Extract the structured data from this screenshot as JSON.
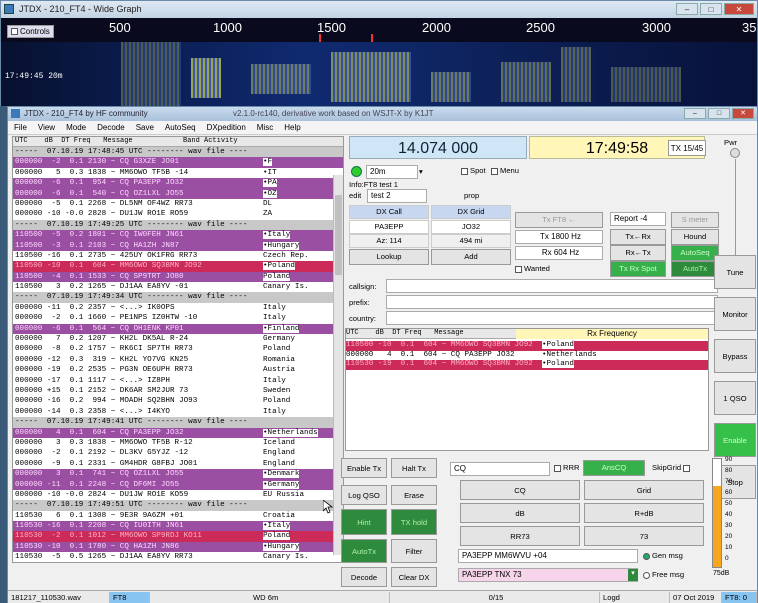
{
  "waterfall": {
    "title": "JTDX - 210_FT4 - Wide Graph",
    "controls_label": "Controls",
    "scale": [
      "500",
      "1000",
      "1500",
      "2000",
      "2500",
      "3000",
      "35"
    ],
    "time_label": "17:49:45   20m",
    "min": "–",
    "max": "□",
    "close": "✕"
  },
  "main": {
    "title": "JTDX - 210_FT4 by HF community",
    "subtitle": "v2.1.0-rc140, derivative work based on WSJT-X by K1JT",
    "min": "–",
    "max": "□",
    "close": "✕"
  },
  "menu": [
    "File",
    "View",
    "Mode",
    "Decode",
    "Save",
    "AutoSeq",
    "DXpedition",
    "Misc",
    "Help"
  ],
  "band_activity": {
    "header": "UTC    dB  DT Freq   Message            Band Activity",
    "rows": [
      {
        "t": "-----  07.10.19 17:48:45 UTC -------- wav file ----",
        "c": "",
        "k": "sep"
      },
      {
        "t": "000000  -2  0.1 2130 ~ CQ G3XZE JO01",
        "c": "•F",
        "k": "cq"
      },
      {
        "t": "000000   5  0.3 1838 ~ MM6OWO TF5B -14",
        "c": "•IT",
        "k": ""
      },
      {
        "t": "000000  -6  0.1  954 ~ CQ PA3EPP JO32",
        "c": "•PA",
        "k": "cq"
      },
      {
        "t": "000000  -6  0.1  540 ~ CQ OZ1LXL JO55",
        "c": "•OZ",
        "k": "cq"
      },
      {
        "t": "000000  -5  0.1 2268 ~ DL5NM OF4WZ RR73",
        "c": "DL",
        "k": ""
      },
      {
        "t": "000000 -10 -0.0 2828 ~ DU1JW RO1E RO59",
        "c": "ZA",
        "k": ""
      },
      {
        "t": "-----  07.10.19 17:49:25 UTC -------- wav file ----",
        "c": "",
        "k": "sep"
      },
      {
        "t": "110500  -5  0.2 1801 ~ CQ IW0FEH JN61",
        "c": "•Italy",
        "k": "cq"
      },
      {
        "t": "110500  -3  0.1 2103 ~ CQ HA1ZH JN87",
        "c": "•Hungary",
        "k": "cq"
      },
      {
        "t": "110500 -16  0.1 2735 ~ 425UY OK1FRG RR73",
        "c": "Czech Rep.",
        "k": ""
      },
      {
        "t": "110500 -10  0.1  604 ~ MM6OWO SQ3BMN JO92",
        "c": "•Poland",
        "k": "me"
      },
      {
        "t": "110500  -4  0.1 1533 ~ CQ SP9TRT JO80",
        "c": "Poland",
        "k": "cq"
      },
      {
        "t": "110500   3  0.2 1265 ~ DJ1AA EA8YV -01",
        "c": "Canary Is.",
        "k": ""
      },
      {
        "t": "-----  07.10.19 17:49:34 UTC -------- wav file ----",
        "c": "",
        "k": "sep"
      },
      {
        "t": "000000 -11  0.2 2357 ~ <...> IK0OPS",
        "c": "Italy",
        "k": ""
      },
      {
        "t": "000000  -2  0.1 1660 ~ PE1NPS IZ0HTW -10",
        "c": "Italy",
        "k": ""
      },
      {
        "t": "000000  -6  0.1  564 ~ CQ OH1ENK KP01",
        "c": "•Finland",
        "k": "cq"
      },
      {
        "t": "000000   7  0.2 1207 ~ KH2L DK5AL R-24",
        "c": "Germany",
        "k": ""
      },
      {
        "t": "000000  -8  0.2 1757 ~ RK6CI SP7TH RR73",
        "c": "Poland",
        "k": ""
      },
      {
        "t": "000000 -12  0.3  319 ~ KH2L YO7VG KN25",
        "c": "Romania",
        "k": ""
      },
      {
        "t": "000000 -19  0.2 2535 ~ PG3N OE6UPH RR73",
        "c": "Austria",
        "k": ""
      },
      {
        "t": "000000 -17  0.1 1117 ~ <...> IZ8PH",
        "c": "Italy",
        "k": ""
      },
      {
        "t": "000000 +15  0.1 2152 ~ DK6AR SM2JUR 73",
        "c": "Sweden",
        "k": ""
      },
      {
        "t": "000000 -16  0.2  994 ~ MOADH SQ2BHN JO93",
        "c": "Poland",
        "k": ""
      },
      {
        "t": "000000 -14  0.3 2358 ~ <...> I4KYO",
        "c": "Italy",
        "k": ""
      },
      {
        "t": "-----  07.10.19 17:49:41 UTC -------- wav file ----",
        "c": "",
        "k": "sep"
      },
      {
        "t": "000000   4  0.1  604 ~ CQ PA3EPP JO32",
        "c": "•Netherlands",
        "k": "cq"
      },
      {
        "t": "000000   3  0.3 1838 ~ MM6OWO TF5B R-12",
        "c": "Iceland",
        "k": ""
      },
      {
        "t": "000000  -2  0.1 2192 ~ DL3KV G5YJZ -12",
        "c": "England",
        "k": ""
      },
      {
        "t": "000000  -9  0.1 2331 ~ GM4HDR G8FBJ JO01",
        "c": "England",
        "k": ""
      },
      {
        "t": "000000   3  0.1  741 ~ CQ OZ1LXL JO55",
        "c": "•Denmark",
        "k": "cq"
      },
      {
        "t": "000000 -11  0.1 2248 ~ CQ DF6MI JO55",
        "c": "•Germany",
        "k": "cq"
      },
      {
        "t": "000000 -10 -0.0 2824 ~ DU1JW RO1E KO59",
        "c": "EU Russia",
        "k": ""
      },
      {
        "t": "-----  07.10.19 17:49:51 UTC -------- wav file ----",
        "c": "",
        "k": "sep"
      },
      {
        "t": "110530   6  0.1 1308 ~ 9E3R 9A6ZM +01",
        "c": "Croatia",
        "k": ""
      },
      {
        "t": "110530 -16  0.1 2208 ~ CQ IU0ITH JN61",
        "c": "•Italy",
        "k": "cq"
      },
      {
        "t": "110530  -2  0.1 1012 ~ MM6OWO SP9RDJ KO11",
        "c": "Poland",
        "k": "me"
      },
      {
        "t": "110530 -10  0.1 1780 ~ CQ HA1ZH JN86",
        "c": "•Hungary",
        "k": "cq"
      },
      {
        "t": "110530  -5  0.5 1265 ~ DJ1AA EA8YV RR73",
        "c": "Canary Is.",
        "k": ""
      },
      {
        "t": "110530 -15  0.3  578 ~ MI0GBC SV5KON KM07",
        "c": "Greece",
        "k": ""
      },
      {
        "t": "110530 -12  0.1 1534 ~ 9E3R SP9TRT -03",
        "c": "Poland",
        "k": ""
      },
      {
        "t": "110530 -18  0.1 2736 ~ 9E3R OK1FRG R-21",
        "c": "Czech Rep.",
        "k": ""
      },
      {
        "t": "110530 -14 -0.0  577 ~ CQ IT9HZR JM76",
        "c": "•Sicily",
        "k": "cq"
      }
    ]
  },
  "freq": "14.074 000",
  "clock": "17:49:58",
  "tx_period": "TX 15/45",
  "pwr": "Pwr",
  "band": {
    "value": "20m",
    "spot": "Spot",
    "menu": "Menu"
  },
  "info": "Info:FT8  test 1",
  "edit": {
    "label": "edit",
    "value": "test 2",
    "prop": "prop"
  },
  "dx": {
    "call_label": "DX Call",
    "grid_label": "DX Grid",
    "call": "PA3EPP",
    "grid": "JO32",
    "az": "Az: 114",
    "dist": "494 mi",
    "lookup": "Lookup",
    "add": "Add"
  },
  "tx": {
    "ft8": "Tx FT8 ←",
    "tx_hz": "Tx  1800 Hz",
    "rx_hz": "Rx  604 Hz",
    "report": "Report -4",
    "smeter": "S meter",
    "txrx": "Tx←Rx",
    "rxtx": "Rx←Tx",
    "hound": "Hound",
    "autoseq": "AutoSeq",
    "wanted": "Wanted",
    "txrxspot": "Tx Rx Spot",
    "autotx": "AutoTx"
  },
  "fields": {
    "callsign": "callsign:",
    "prefix": "prefix:",
    "country": "country:"
  },
  "rx": {
    "header": "UTC    dB  DT Freq   Message",
    "title": "Rx Frequency",
    "rows": [
      {
        "t": "110500 -10  0.1  604 ~ MM6OWO SQ3BMN JO92",
        "c": "•Poland",
        "k": "me"
      },
      {
        "t": "000000   4  0.1  604 ~ CQ PA3EPP JO32",
        "c": "•Netherlands",
        "k": ""
      },
      {
        "t": "110530 -19  0.1  604 ~ MM6OWO SQ3BMN JO92",
        "c": "•Poland",
        "k": "me"
      }
    ]
  },
  "side": {
    "tune": "Tune",
    "monitor": "Monitor",
    "bypass": "Bypass",
    "qso": "1 QSO",
    "enable": "Enable",
    "stop": "Stop"
  },
  "controls": {
    "enable_tx": "Enable Tx",
    "halt_tx": "Halt Tx",
    "log_qso": "Log QSO",
    "erase": "Erase",
    "hint": "Hint",
    "tx_hold": "TX hold",
    "autotx": "AutoTx",
    "filter": "Filter",
    "decode": "Decode",
    "clear_dx": "Clear DX"
  },
  "msgs": {
    "cq": "CQ",
    "rrr": "RRR",
    "anscq": "AnsCQ",
    "skip": "SkipGrid",
    "cq_btn": "CQ",
    "grid": "Grid",
    "db": "dB",
    "rdb": "R+dB",
    "rr73": "RR73",
    "s73": "73",
    "gen_text": "PA3EPP MM6WVU +04",
    "gen": "Gen msg",
    "free_text": "PA3EPP TNX 73",
    "free": "Free msg"
  },
  "meter": [
    "90",
    "80",
    "70",
    "60",
    "50",
    "40",
    "30",
    "20",
    "10",
    "0"
  ],
  "meter_db": "75dB",
  "status": {
    "wav": "181217_110530.wav",
    "mode": "FT8",
    "wd": "WD 6m",
    "count": "0/15",
    "logd": "Logd",
    "date": "07 Oct 2019",
    "ft8": "FT8: 0"
  },
  "colors": {
    "cq": "#9a4fa2",
    "me": "#cc2a58",
    "freq_bg": "#cfe6f6",
    "clock_bg": "#fff6b8",
    "green": "#36b04a"
  }
}
